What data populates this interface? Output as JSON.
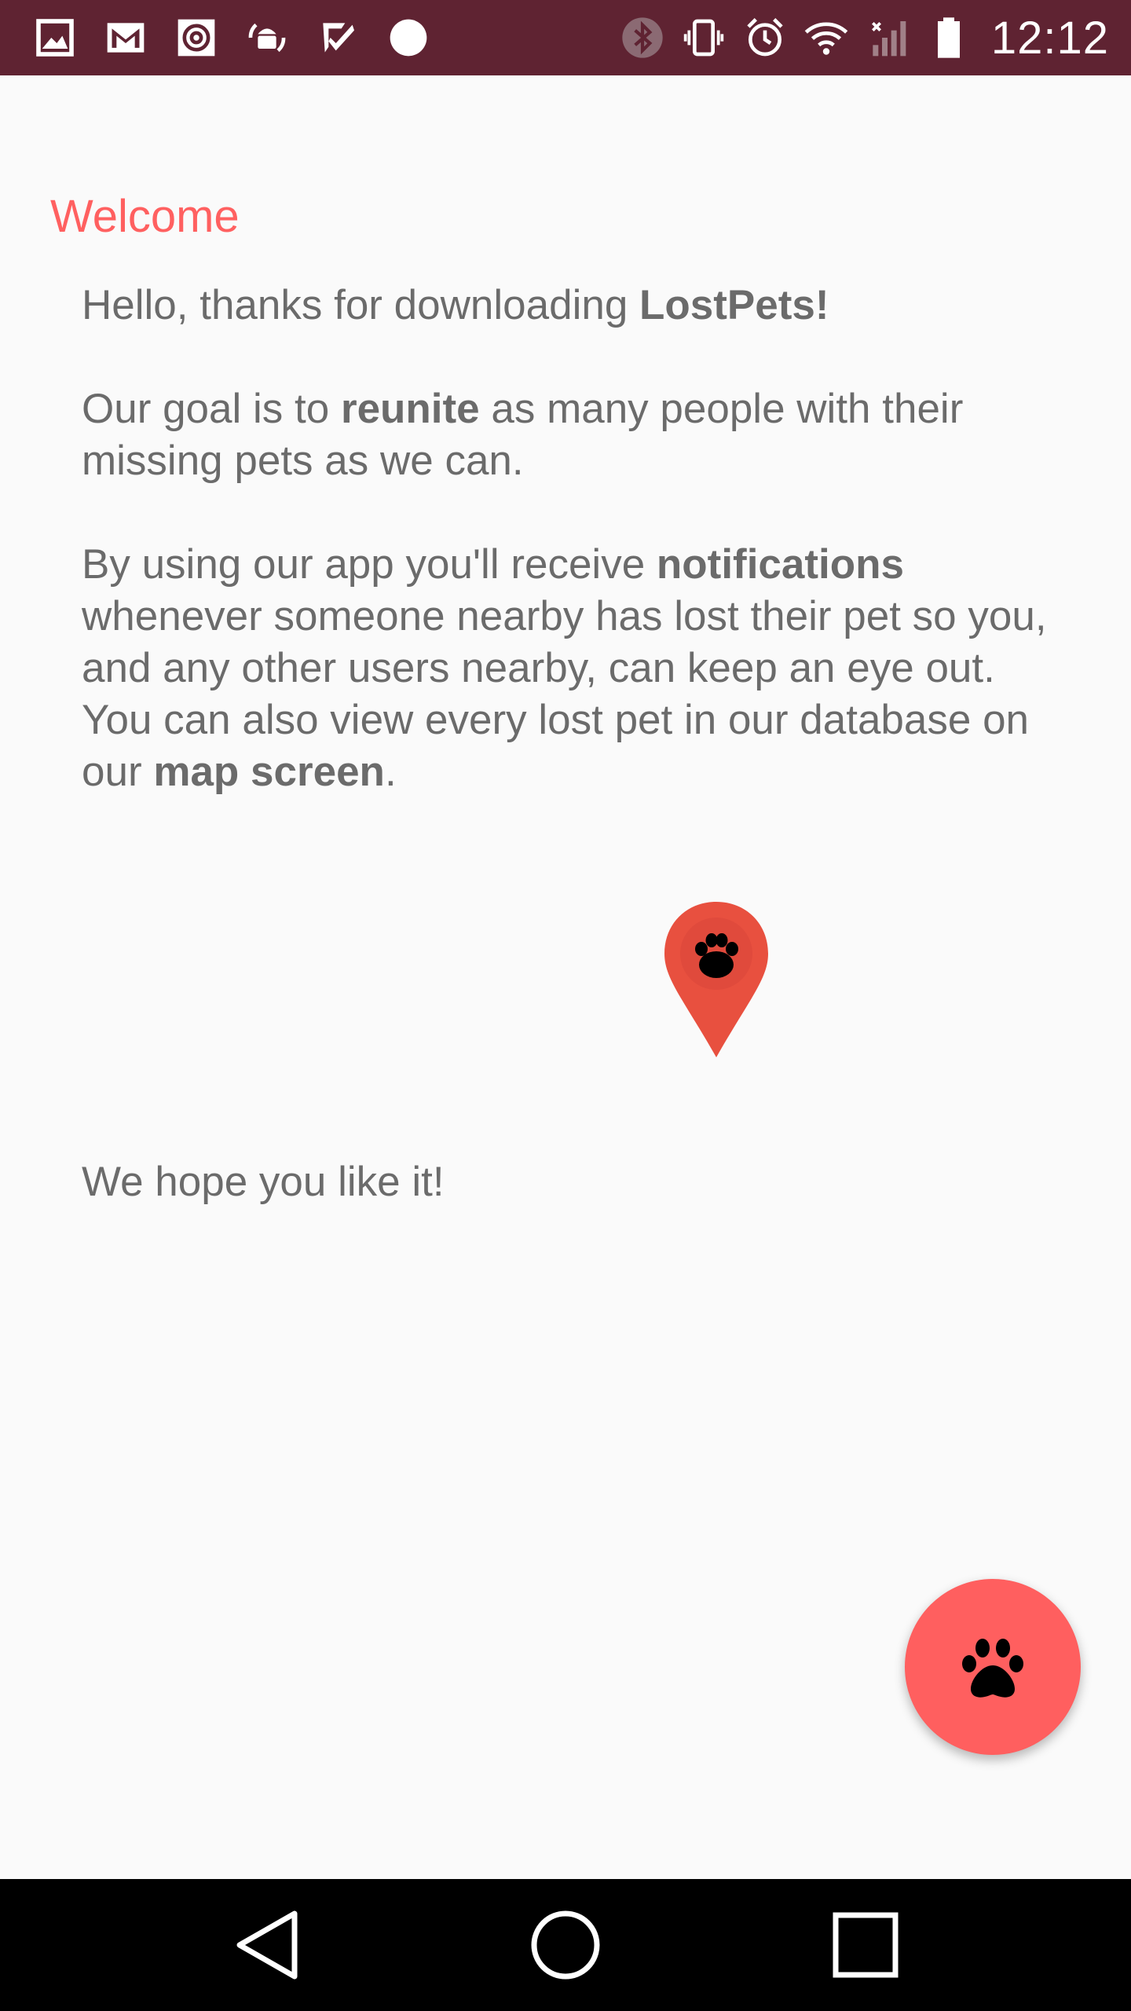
{
  "status_bar": {
    "time": "12:12",
    "background": "#5f2332",
    "left_icons": [
      "gallery-icon",
      "gmail-icon",
      "email-at-icon",
      "android-sync-icon",
      "check-icon",
      "circle-dot-icon"
    ],
    "right_icons": [
      "bluetooth-icon",
      "vibrate-icon",
      "alarm-icon",
      "wifi-icon",
      "signal-icon",
      "battery-icon"
    ]
  },
  "welcome": {
    "title": "Welcome",
    "title_color": "#ff6060"
  },
  "body": {
    "p1": {
      "text": "Hello, thanks for downloading ",
      "bold": "LostPets!"
    },
    "p2": {
      "before": "Our goal is to ",
      "bold": "reunite",
      "after": " as many people with their missing pets as we can."
    },
    "p3": {
      "before": "By using our app you'll receive ",
      "bold": "notifications",
      "after": " whenever someone nearby has lost their pet so you, and any other users nearby, can keep an eye out."
    },
    "p3b": {
      "before": "You can also view every lost pet in our database on our ",
      "bold": "map screen",
      "after": "."
    },
    "closing": "We hope you like it!"
  },
  "pin": {
    "icon": "paw-map-pin-icon",
    "color": "#e8503f"
  },
  "fab": {
    "icon": "paw-icon",
    "color": "#ff5f5f"
  },
  "nav_bar": {
    "buttons": [
      "back-icon",
      "home-icon",
      "recents-icon"
    ]
  }
}
